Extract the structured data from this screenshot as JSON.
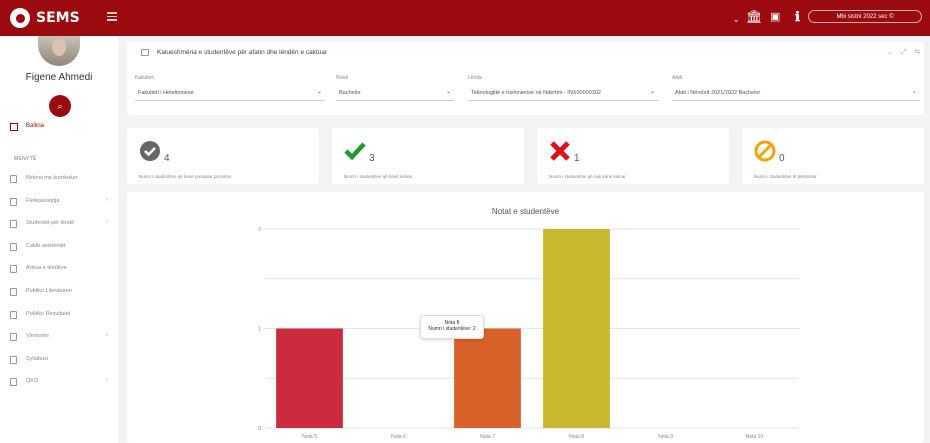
{
  "app": {
    "name": "SEMS",
    "session": "Mbi sistni 2022 sec ©"
  },
  "user": {
    "name": "Figene Ahmedi"
  },
  "sidebar": {
    "active_item": "Ballina",
    "section_heading": "MENYTË",
    "items": [
      {
        "label": "Nxënsi me kurrikulun",
        "arrow": ""
      },
      {
        "label": "Fletëparaqitja",
        "arrow": "›"
      },
      {
        "label": "Studentët për lëndë",
        "arrow": "›"
      },
      {
        "label": "Cakto asistentët",
        "arrow": ""
      },
      {
        "label": "Arkiva e lëndëve",
        "arrow": ""
      },
      {
        "label": "Publiko Literaturen",
        "arrow": ""
      },
      {
        "label": "Publiko Rezultatet",
        "arrow": ""
      },
      {
        "label": "Vlerësimi",
        "arrow": "›"
      },
      {
        "label": "Syllabusi",
        "arrow": ""
      },
      {
        "label": "QKO",
        "arrow": "›"
      }
    ]
  },
  "filters": {
    "title": "Kalueshmëria e studentëve për afatin dhe lëndën e caktuar",
    "fields": [
      {
        "label": "Fakulteti",
        "value": "Fakulteti i Heteltoniese"
      },
      {
        "label": "Niveli",
        "value": "Bachelor"
      },
      {
        "label": "Lënda",
        "value": "Teknologjitë e Inxhinierisë në Ndërtim - INX00000302"
      },
      {
        "label": "Afati",
        "value": "Afati i Nëntorit 2021/2022 Bachelor"
      }
    ]
  },
  "stats": [
    {
      "icon": "passed-check-icon",
      "value": "4",
      "label": "Numri i studentëve që kanë paraqitur provimin",
      "color": "#666666"
    },
    {
      "icon": "green-check-icon",
      "value": "3",
      "label": "Numri i studentëve që kanë kaluar",
      "color": "#1a9b2c"
    },
    {
      "icon": "red-x-icon",
      "value": "1",
      "label": "Numri i studentëve që nuk kanë kaluar",
      "color": "#e0101a"
    },
    {
      "icon": "ban-icon",
      "value": "0",
      "label": "Numri i studentëve të përsëritur",
      "color": "#f5a300"
    }
  ],
  "tooltip": {
    "line1": "Nota 8",
    "line2": "Numri i studentëve: 2"
  },
  "chart_data": {
    "type": "bar",
    "title": "Notat e studentëve",
    "categories": [
      "Nota 5",
      "Nota 6",
      "Nota 7",
      "Nota 8",
      "Nota 9",
      "Nota 10"
    ],
    "values": [
      1,
      0,
      1,
      2,
      0,
      0
    ],
    "colors": [
      "#cc2a3d",
      "#cc2a3d",
      "#d9622b",
      "#c8b82e",
      "#c8b82e",
      "#c8b82e"
    ],
    "yticks": [
      "0",
      "1",
      "2"
    ],
    "ylim": [
      0,
      2
    ],
    "grid": true
  }
}
